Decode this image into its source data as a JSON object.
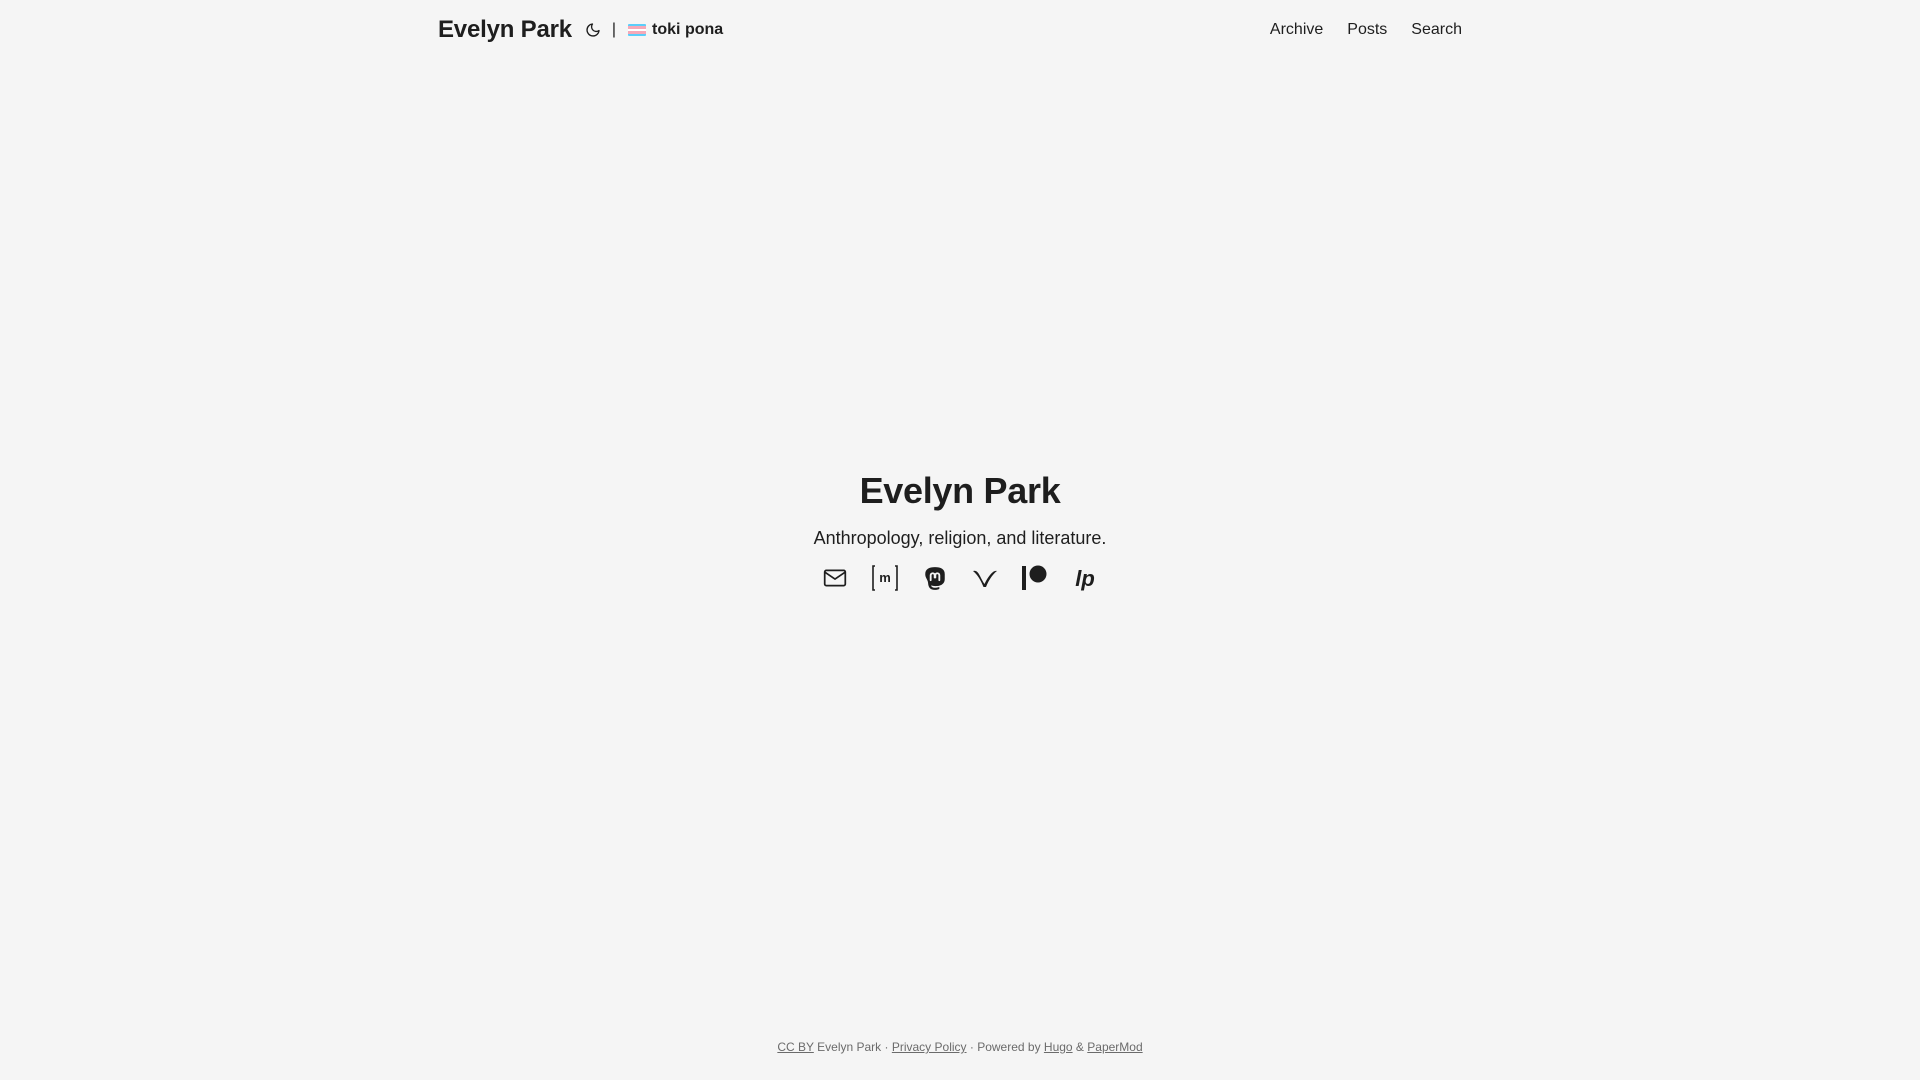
{
  "header": {
    "logo": "Evelyn Park",
    "theme_toggle_icon": "moon-icon",
    "separator": "|",
    "language": {
      "label": "toki pona",
      "flag_icon": "transgender-flag-icon",
      "flag_colors": [
        "#5BCEFA",
        "#F5A9B8",
        "#FFFFFF",
        "#F5A9B8",
        "#5BCEFA"
      ]
    },
    "nav": {
      "archive": "Archive",
      "posts": "Posts",
      "search": "Search"
    }
  },
  "hero": {
    "title": "Evelyn Park",
    "subtitle": "Anthropology, religion, and literature.",
    "social_icons": [
      "email-icon",
      "matrix-icon",
      "mastodon-icon",
      "vimeo-icon",
      "patreon-icon",
      "liberapay-icon"
    ]
  },
  "footer": {
    "license": "CC BY",
    "owner": " Evelyn Park · ",
    "privacy": "Privacy Policy",
    "powered": " · Powered by ",
    "hugo": "Hugo",
    "amp": " & ",
    "papermod": "PaperMod"
  },
  "colors": {
    "background": "#f5f5f5",
    "text": "#1e1e1e",
    "footer_text": "#6b6b6b"
  }
}
